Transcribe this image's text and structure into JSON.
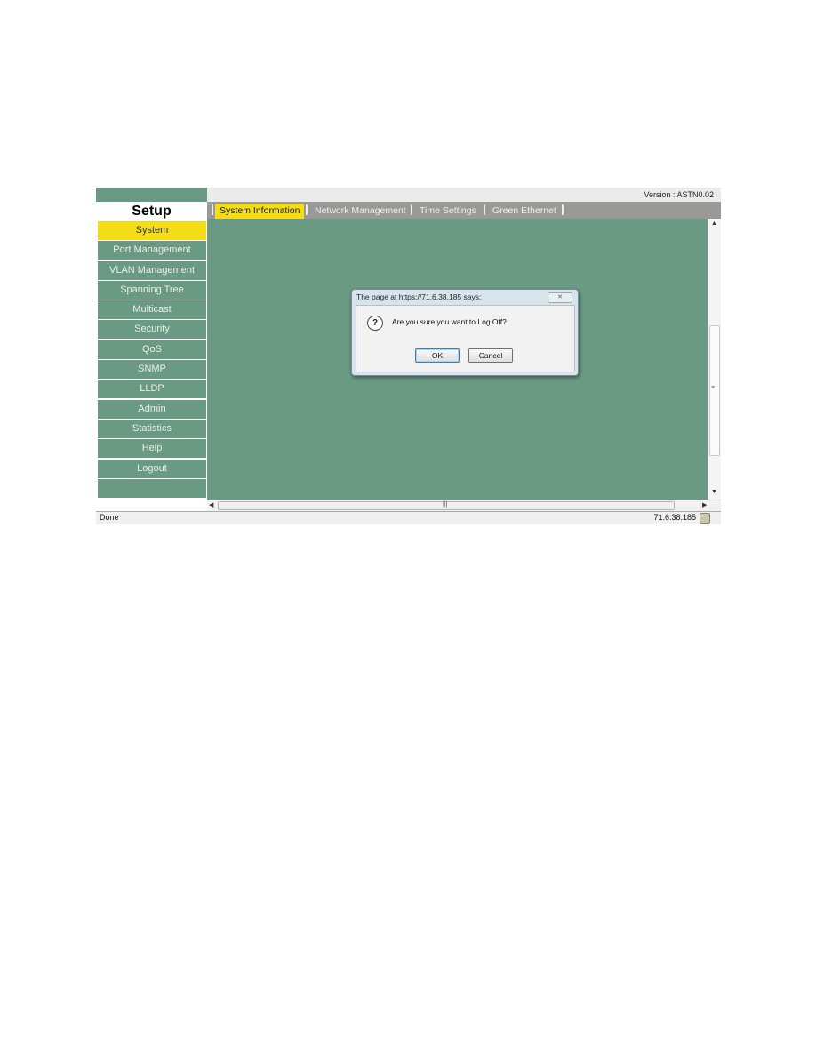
{
  "sidebar": {
    "title": "Setup",
    "items": [
      {
        "label": "System",
        "active": true
      },
      {
        "label": "Port Management",
        "active": false
      },
      {
        "label": "VLAN Management",
        "active": false
      },
      {
        "label": "Spanning Tree",
        "active": false
      },
      {
        "label": "Multicast",
        "active": false
      },
      {
        "label": "Security",
        "active": false
      },
      {
        "label": "QoS",
        "active": false
      },
      {
        "label": "SNMP",
        "active": false
      },
      {
        "label": "LLDP",
        "active": false
      },
      {
        "label": "Admin",
        "active": false
      },
      {
        "label": "Statistics",
        "active": false
      },
      {
        "label": "Help",
        "active": false
      },
      {
        "label": "Logout",
        "active": false
      }
    ]
  },
  "header": {
    "version": "Version :  ASTN0.02"
  },
  "tabs": [
    {
      "label": "System Information",
      "active": true
    },
    {
      "label": "Network Management",
      "active": false
    },
    {
      "label": "Time Settings",
      "active": false
    },
    {
      "label": "Green Ethernet",
      "active": false
    }
  ],
  "dialog": {
    "title": "The page at https://71.6.38.185 says:",
    "close_icon": "close-icon",
    "icon": "question-icon",
    "message": "Are you sure you want to Log Off?",
    "ok_label": "OK",
    "cancel_label": "Cancel"
  },
  "statusbar": {
    "status": "Done",
    "ip": "71.6.38.185"
  },
  "colors": {
    "menu_bg": "#6b9a84",
    "active": "#f4dc16",
    "tabbar": "#999a98"
  }
}
